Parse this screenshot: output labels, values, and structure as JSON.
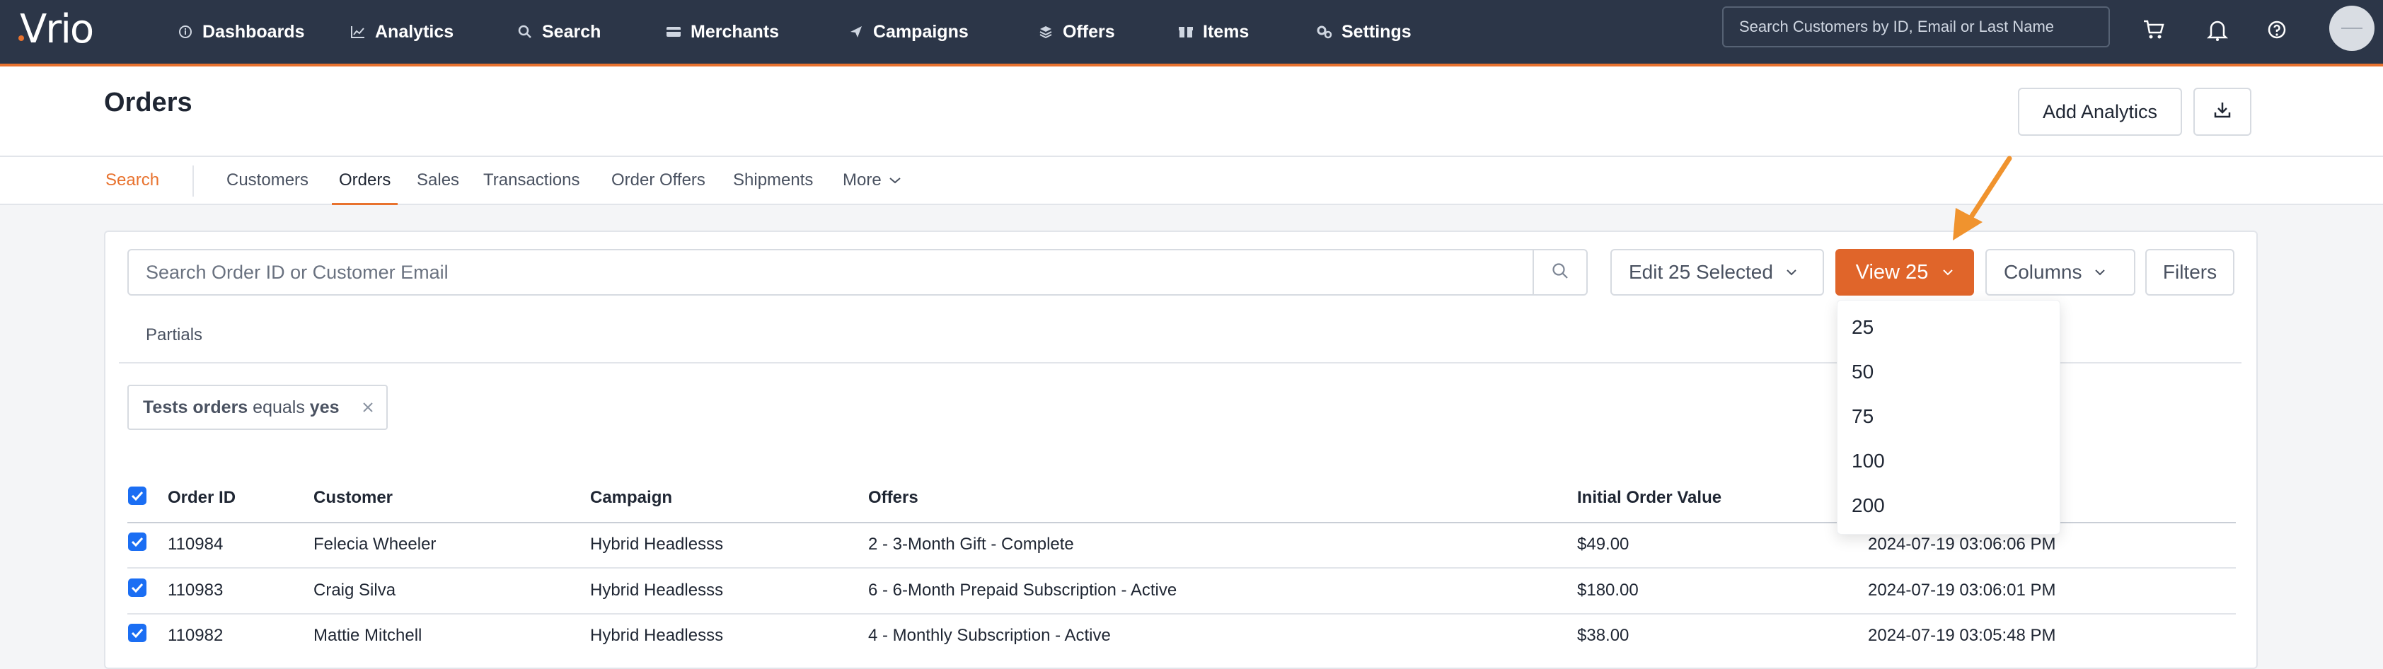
{
  "app": {
    "logo": "Vrio",
    "nav": [
      {
        "label": "Dashboards",
        "icon": "info-circle-icon"
      },
      {
        "label": "Analytics",
        "icon": "line-chart-icon"
      },
      {
        "label": "Search",
        "icon": "search-icon"
      },
      {
        "label": "Merchants",
        "icon": "credit-card-icon"
      },
      {
        "label": "Campaigns",
        "icon": "paper-plane-icon"
      },
      {
        "label": "Offers",
        "icon": "layers-icon"
      },
      {
        "label": "Items",
        "icon": "box-icon"
      },
      {
        "label": "Settings",
        "icon": "gears-icon"
      }
    ],
    "global_search_placeholder": "Search Customers by ID, Email or Last Name",
    "colors": {
      "nav_bg": "#2c3648",
      "accent": "#e8722e",
      "primary_btn": "#e0652a",
      "checkbox": "#1b6ef3"
    }
  },
  "header": {
    "title": "Orders",
    "add_analytics": "Add Analytics",
    "download_icon": "download-icon"
  },
  "subnav": {
    "items": [
      "Search",
      "Customers",
      "Orders",
      "Sales",
      "Transactions",
      "Order Offers",
      "Shipments",
      "More"
    ],
    "active": "Orders"
  },
  "toolbar": {
    "search_placeholder": "Search Order ID or Customer Email",
    "edit_selected": "Edit 25 Selected",
    "view": "View 25",
    "columns": "Columns",
    "filters": "Filters"
  },
  "view_dropdown": {
    "options": [
      "25",
      "50",
      "75",
      "100",
      "200"
    ]
  },
  "tabs": {
    "partials": "Partials"
  },
  "filter_chip": {
    "field": "Tests orders",
    "op": "equals",
    "value": "yes"
  },
  "table": {
    "headers": [
      "Order ID",
      "Customer",
      "Campaign",
      "Offers",
      "Initial Order Value"
    ],
    "rows": [
      {
        "id": "110984",
        "customer": "Felecia Wheeler",
        "campaign": "Hybrid Headlesss",
        "offers": "2 - 3-Month Gift - Complete",
        "value": "$49.00",
        "date": "2024-07-19 03:06:06 PM"
      },
      {
        "id": "110983",
        "customer": "Craig Silva",
        "campaign": "Hybrid Headlesss",
        "offers": "6 - 6-Month Prepaid Subscription - Active",
        "value": "$180.00",
        "date": "2024-07-19 03:06:01 PM"
      },
      {
        "id": "110982",
        "customer": "Mattie Mitchell",
        "campaign": "Hybrid Headlesss",
        "offers": "4 - Monthly Subscription - Active",
        "value": "$38.00",
        "date": "2024-07-19 03:05:48 PM"
      }
    ]
  }
}
